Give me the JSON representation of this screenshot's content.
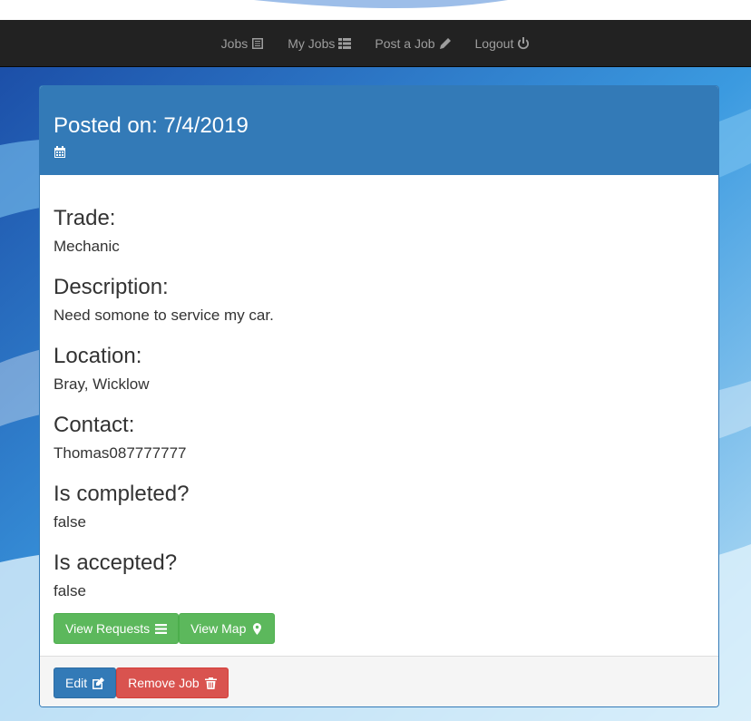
{
  "nav": {
    "items": [
      {
        "label": "Jobs",
        "icon": "list-alt-icon"
      },
      {
        "label": "My Jobs",
        "icon": "th-list-icon"
      },
      {
        "label": "Post a Job",
        "icon": "pencil-icon"
      },
      {
        "label": "Logout",
        "icon": "power-icon"
      }
    ]
  },
  "job": {
    "posted_on": "Posted on: 7/4/2019",
    "fields": [
      {
        "label": "Trade:",
        "value": "Mechanic"
      },
      {
        "label": "Description:",
        "value": "Need somone to service my car."
      },
      {
        "label": "Location:",
        "value": "Bray, Wicklow"
      },
      {
        "label": "Contact:",
        "value": "Thomas087777777"
      },
      {
        "label": "Is completed?",
        "value": "false"
      },
      {
        "label": "Is accepted?",
        "value": "false"
      }
    ]
  },
  "actions": {
    "view_requests": "View Requests",
    "view_map": "View Map"
  },
  "footer": {
    "edit": "Edit",
    "remove_job": "Remove Job"
  },
  "colors": {
    "navbar": "#222222",
    "panel_primary": "#337ab7",
    "success": "#5cb85c",
    "danger": "#d9534f"
  }
}
